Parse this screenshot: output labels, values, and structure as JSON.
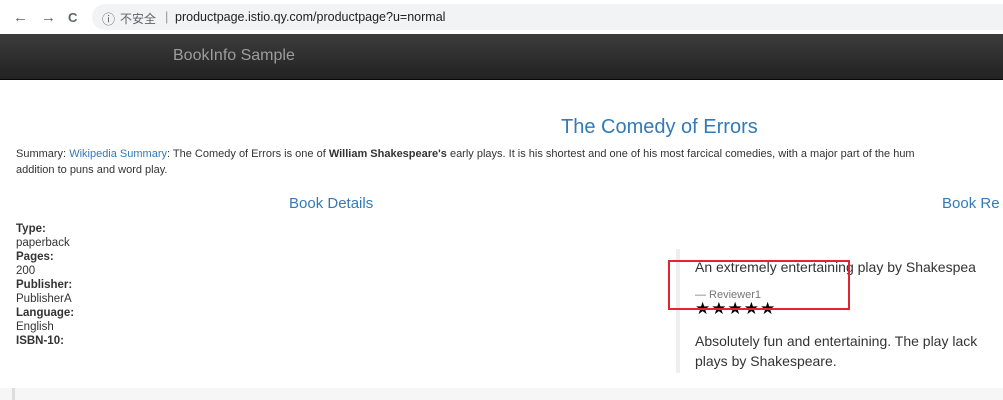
{
  "browser": {
    "back_icon": "←",
    "forward_icon": "→",
    "reload_icon": "C",
    "info_icon": "ⓘ",
    "secure_label": "不安全",
    "separator": "|",
    "url": "productpage.istio.qy.com/productpage?u=normal"
  },
  "navbar": {
    "brand": "BookInfo Sample"
  },
  "book": {
    "title": "The Comedy of Errors",
    "summary_label": "Summary:",
    "summary_link": "Wikipedia Summary",
    "summary_text_1": ": The Comedy of Errors is one of ",
    "summary_author": "William Shakespeare's",
    "summary_text_2": " early plays. It is his shortest and one of his most farcical comedies, with a major part of the hum",
    "summary_line2": "addition to puns and word play."
  },
  "details": {
    "heading": "Book Details",
    "type_label": "Type:",
    "type_value": "paperback",
    "pages_label": "Pages:",
    "pages_value": "200",
    "publisher_label": "Publisher:",
    "publisher_value": "PublisherA",
    "language_label": "Language:",
    "language_value": "English",
    "isbn_label": "ISBN-10:"
  },
  "reviews": {
    "heading": "Book Re",
    "items": [
      {
        "text": "An extremely entertaining play by Shakespea",
        "reviewer": "— Reviewer1",
        "stars": "★★★★★"
      },
      {
        "text_line1": "Absolutely fun and entertaining. The play lack",
        "text_line2": "plays by Shakespeare."
      }
    ]
  },
  "colors": {
    "link": "#337ab7",
    "navbar": "#222222",
    "highlight": "#e0262f"
  }
}
